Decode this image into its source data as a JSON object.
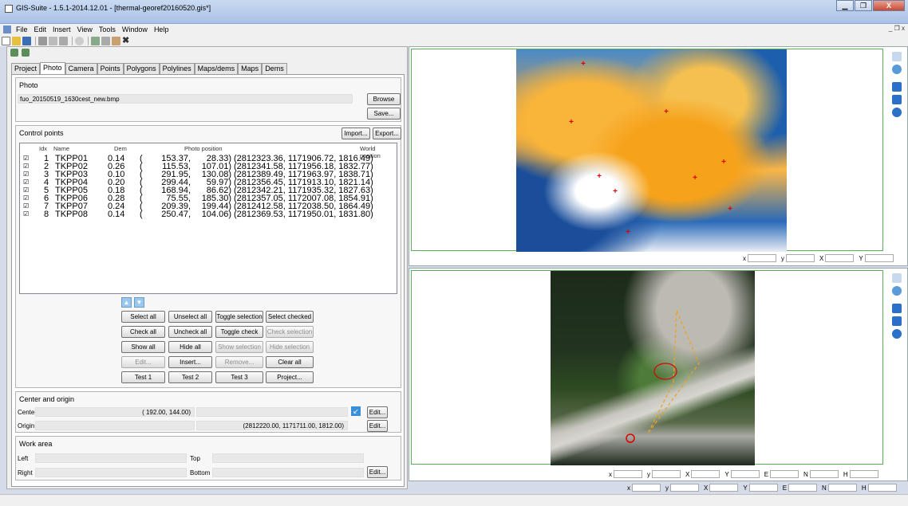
{
  "window": {
    "title": "GIS-Suite - 1.5.1-2014.12.01 - [thermal-georef20160520.gis*]",
    "controls": [
      "▁",
      "❐",
      "X"
    ]
  },
  "menu": [
    "File",
    "Edit",
    "Insert",
    "View",
    "Tools",
    "Window",
    "Help"
  ],
  "mdi_controls": "_ ❐ x",
  "tabs": [
    "Project",
    "Photo",
    "Camera",
    "Points",
    "Polygons",
    "Polylines",
    "Maps/dems",
    "Maps",
    "Dems"
  ],
  "photo": {
    "group_title": "Photo",
    "filename": "fuo_20150519_1630cest_new.bmp",
    "browse": "Browse",
    "save": "Save..."
  },
  "control_points": {
    "group_title": "Control points",
    "import": "Import...",
    "export": "Export...",
    "headers": {
      "idx": "Idx",
      "name": "Name",
      "dem": "Dem",
      "photo": "Photo position",
      "world": "World position"
    },
    "rows": [
      {
        "check": "☑",
        "idx": "1",
        "name": "TKPP01",
        "dem": "0.14",
        "px": "153.37,",
        "py": "28.33)",
        "world": "(2812323.36, 1171906.72, 1816.49)"
      },
      {
        "check": "☑",
        "idx": "2",
        "name": "TKPP02",
        "dem": "0.26",
        "px": "115.53,",
        "py": "107.01)",
        "world": "(2812341.58, 1171956.18, 1832.77)"
      },
      {
        "check": "☑",
        "idx": "3",
        "name": "TKPP03",
        "dem": "0.10",
        "px": "291.95,",
        "py": "130.08)",
        "world": "(2812389.49, 1171963.97, 1838.71)"
      },
      {
        "check": "☑",
        "idx": "4",
        "name": "TKPP04",
        "dem": "0.20",
        "px": "299.44,",
        "py": "59.97)",
        "world": "(2812356.45, 1171913.10, 1821.14)"
      },
      {
        "check": "☑",
        "idx": "5",
        "name": "TKPP05",
        "dem": "0.18",
        "px": "168.94,",
        "py": "86.62)",
        "world": "(2812342.21, 1171935.32, 1827.63)"
      },
      {
        "check": "☑",
        "idx": "6",
        "name": "TKPP06",
        "dem": "0.28",
        "px": "75.55,",
        "py": "185.30)",
        "world": "(2812357.05, 1172007.08, 1854.91)"
      },
      {
        "check": "☑",
        "idx": "7",
        "name": "TKPP07",
        "dem": "0.24",
        "px": "209.39,",
        "py": "199.44)",
        "world": "(2812412.58, 1172038.50, 1864.49)"
      },
      {
        "check": "☑",
        "idx": "8",
        "name": "TKPP08",
        "dem": "0.14",
        "px": "250.47,",
        "py": "104.06)",
        "world": "(2812369.53, 1171950.01, 1831.80)"
      }
    ],
    "buttons": [
      [
        "Select all",
        "Unselect all",
        "Toggle selection",
        "Select checked"
      ],
      [
        "Check all",
        "Uncheck all",
        "Toggle check",
        "Check selection"
      ],
      [
        "Show all",
        "Hide all",
        "Show selection",
        "Hide selection"
      ],
      [
        "Edit...",
        "Insert...",
        "Remove...",
        "Clear all"
      ],
      [
        "Test 1",
        "Test 2",
        "Test 3",
        "Project..."
      ]
    ]
  },
  "center_origin": {
    "group_title": "Center and origin",
    "center_label": "Center",
    "center_value": "( 192.00,   144.00)",
    "origin_label": "Origin",
    "origin_value": "(2812220.00, 1171711.00, 1812.00)",
    "edit": "Edit..."
  },
  "work_area": {
    "group_title": "Work area",
    "left": "Left",
    "top": "Top",
    "right": "Right",
    "bottom": "Bottom",
    "edit": "Edit..."
  },
  "coords_top": [
    "x",
    "y",
    "X",
    "Y"
  ],
  "coords_bottom": [
    "x",
    "y",
    "X",
    "Y",
    "E",
    "N",
    "H"
  ],
  "status_coords": [
    "x",
    "y",
    "X",
    "Y",
    "E",
    "N",
    "H"
  ],
  "colors": {
    "accent": "#3a6fb5",
    "viewer_border": "#58b058",
    "marker": "#dd0000"
  }
}
